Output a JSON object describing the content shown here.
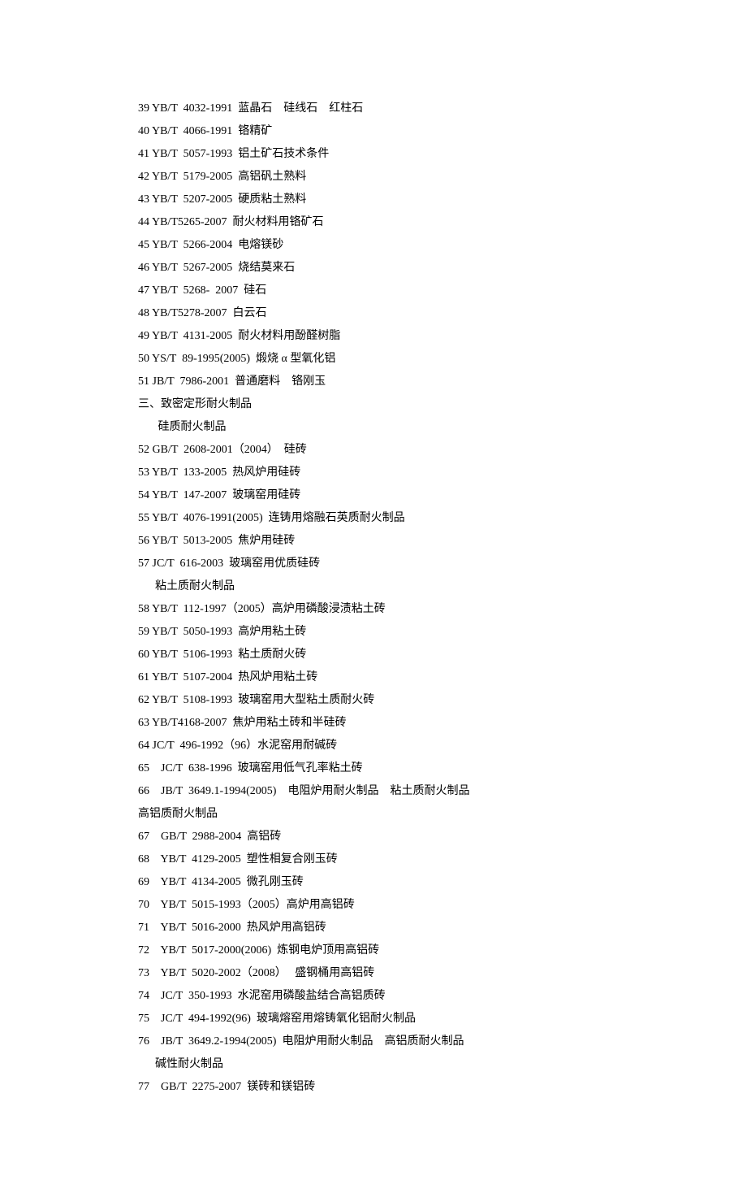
{
  "lines": [
    "39 YB/T  4032-1991  蓝晶石    硅线石    红柱石",
    "40 YB/T  4066-1991  铬精矿",
    "41 YB/T  5057-1993  铝土矿石技术条件",
    "42 YB/T  5179-2005  高铝矾土熟料",
    "43 YB/T  5207-2005  硬质粘土熟料",
    "44 YB/T5265-2007  耐火材料用铬矿石",
    "45 YB/T  5266-2004  电熔镁砂",
    "46 YB/T  5267-2005  烧结莫来石",
    "47 YB/T  5268-  2007  硅石",
    "48 YB/T5278-2007  白云石",
    "49 YB/T  4131-2005  耐火材料用酚醛树脂",
    "50 YS/T  89-1995(2005)  煅烧 α 型氧化铝",
    "51 JB/T  7986-2001  普通磨料    铬刚玉",
    "三、致密定形耐火制品",
    "       硅质耐火制品",
    "52 GB/T  2608-2001（2004）  硅砖",
    "53 YB/T  133-2005  热风炉用硅砖",
    "54 YB/T  147-2007  玻璃窑用硅砖",
    "55 YB/T  4076-1991(2005)  连铸用熔融石英质耐火制品",
    "56 YB/T  5013-2005  焦炉用硅砖",
    "57 JC/T  616-2003  玻璃窑用优质硅砖",
    "      粘土质耐火制品",
    "58 YB/T  112-1997（2005）高炉用磷酸浸渍粘土砖",
    "59 YB/T  5050-1993  高炉用粘土砖",
    "60 YB/T  5106-1993  粘土质耐火砖",
    "61 YB/T  5107-2004  热风炉用粘土砖",
    "62 YB/T  5108-1993  玻璃窑用大型粘土质耐火砖",
    "63 YB/T4168-2007  焦炉用粘土砖和半硅砖",
    "64 JC/T  496-1992（96）水泥窑用耐碱砖",
    "65    JC/T  638-1996  玻璃窑用低气孔率粘土砖",
    "66    JB/T  3649.1-1994(2005)    电阻炉用耐火制品    粘土质耐火制品",
    "高铝质耐火制品",
    "67    GB/T  2988-2004  高铝砖",
    "68    YB/T  4129-2005  塑性相复合刚玉砖",
    "69    YB/T  4134-2005  微孔刚玉砖",
    "70    YB/T  5015-1993（2005）高炉用高铝砖",
    "71    YB/T  5016-2000  热风炉用高铝砖",
    "72    YB/T  5017-2000(2006)  炼钢电炉顶用高铝砖",
    "73    YB/T  5020-2002（2008）   盛钢桶用高铝砖",
    "74    JC/T  350-1993  水泥窑用磷酸盐结合高铝质砖",
    "75    JC/T  494-1992(96)  玻璃熔窑用熔铸氧化铝耐火制品",
    "76    JB/T  3649.2-1994(2005)  电阻炉用耐火制品    高铝质耐火制品",
    "      碱性耐火制品",
    "77    GB/T  2275-2007  镁砖和镁铝砖"
  ]
}
